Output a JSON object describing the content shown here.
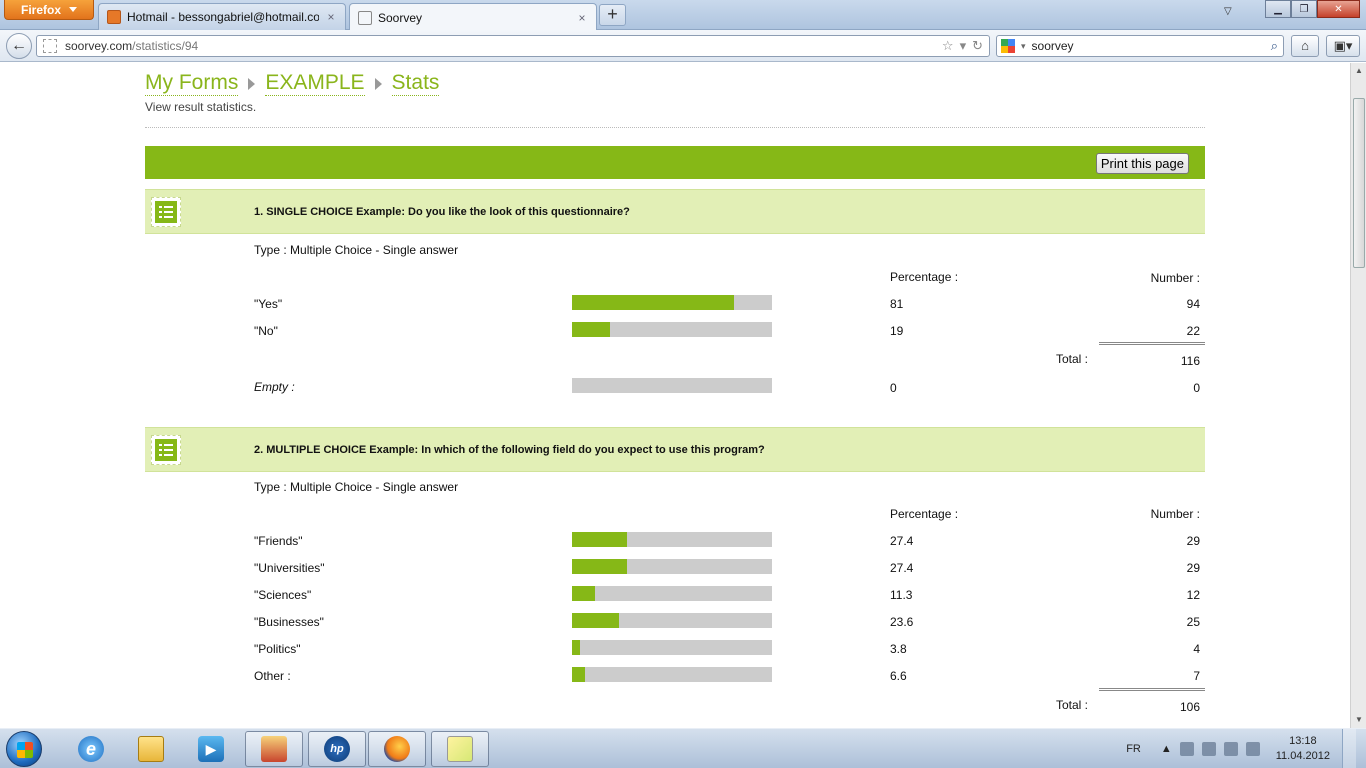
{
  "browser": {
    "menu_button": "Firefox",
    "tabs": [
      {
        "label": "Hotmail - bessongabriel@hotmail.com",
        "close": "×"
      },
      {
        "label": "Soorvey",
        "close": "×"
      }
    ],
    "new_tab": "+",
    "url_domain": "soorvey.com",
    "url_path": "/statistics/94",
    "search_value": "soorvey"
  },
  "page": {
    "breadcrumb": [
      "My Forms",
      "EXAMPLE",
      "Stats"
    ],
    "subtitle": "View result statistics.",
    "print_button": "Print this page",
    "colors": {
      "accent": "#86b817",
      "header_bg": "#e2efb6",
      "bar_empty": "#cccccc"
    },
    "questions": [
      {
        "title": "1. SINGLE CHOICE Example: Do you like the look of this questionnaire?",
        "type": "Type : Multiple Choice - Single answer",
        "col_percentage": "Percentage :",
        "col_number": "Number :",
        "answers": [
          {
            "label": "\"Yes\"",
            "percentage": "81",
            "number": "94",
            "fill": 0.81
          },
          {
            "label": "\"No\"",
            "percentage": "19",
            "number": "22",
            "fill": 0.19
          }
        ],
        "total_label": "Total :",
        "total": "116",
        "empty": {
          "label": "Empty :",
          "percentage": "0",
          "number": "0",
          "fill": 0
        }
      },
      {
        "title": "2. MULTIPLE CHOICE Example: In which of the following field do you expect to use this program?",
        "type": "Type : Multiple Choice - Single answer",
        "col_percentage": "Percentage :",
        "col_number": "Number :",
        "answers": [
          {
            "label": "\"Friends\"",
            "percentage": "27.4",
            "number": "29",
            "fill": 0.274
          },
          {
            "label": "\"Universities\"",
            "percentage": "27.4",
            "number": "29",
            "fill": 0.274
          },
          {
            "label": "\"Sciences\"",
            "percentage": "11.3",
            "number": "12",
            "fill": 0.113
          },
          {
            "label": "\"Businesses\"",
            "percentage": "23.6",
            "number": "25",
            "fill": 0.236
          },
          {
            "label": "\"Politics\"",
            "percentage": "3.8",
            "number": "4",
            "fill": 0.038
          },
          {
            "label": "Other :",
            "percentage": "6.6",
            "number": "7",
            "fill": 0.066
          }
        ],
        "total_label": "Total :",
        "total": "106"
      }
    ]
  },
  "taskbar": {
    "language": "FR",
    "time": "13:18",
    "date": "11.04.2012",
    "apps": [
      "internet-explorer-icon",
      "explorer-icon",
      "media-player-icon",
      "app-icon",
      "hp-icon",
      "firefox-icon",
      "sticky-notes-icon"
    ]
  }
}
